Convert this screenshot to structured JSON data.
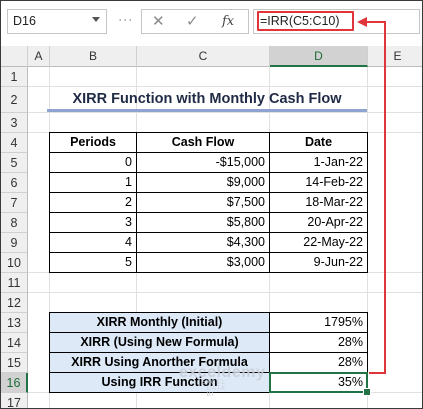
{
  "formula_bar": {
    "name_box": "D16",
    "cancel_symbol": "✕",
    "enter_symbol": "✓",
    "fx_symbol": "fx",
    "formula": "=IRR(C5:C10)"
  },
  "columns": [
    "A",
    "B",
    "C",
    "D",
    "E"
  ],
  "selected_column": "D",
  "rows": [
    "1",
    "2",
    "3",
    "4",
    "5",
    "6",
    "7",
    "8",
    "9",
    "10",
    "11",
    "12",
    "13",
    "14",
    "15",
    "16",
    "17"
  ],
  "selected_row": "16",
  "title": "XIRR Function with Monthly Cash Flow",
  "table": {
    "headers": {
      "periods": "Periods",
      "cash_flow": "Cash Flow",
      "date": "Date"
    },
    "rows": [
      {
        "period": "0",
        "cash_flow": "-$15,000",
        "date": "1-Jan-22"
      },
      {
        "period": "1",
        "cash_flow": "$9,000",
        "date": "14-Feb-22"
      },
      {
        "period": "2",
        "cash_flow": "$7,500",
        "date": "18-Mar-22"
      },
      {
        "period": "3",
        "cash_flow": "$5,800",
        "date": "20-Apr-22"
      },
      {
        "period": "4",
        "cash_flow": "$4,300",
        "date": "22-May-22"
      },
      {
        "period": "5",
        "cash_flow": "$3,000",
        "date": "9-Jun-22"
      }
    ]
  },
  "results": [
    {
      "label": "XIRR Monthly (Initial)",
      "value": "1795%"
    },
    {
      "label": "XIRR (Using New Formula)",
      "value": "28%"
    },
    {
      "label": "XIRR Using Anorther Formula",
      "value": "28%"
    },
    {
      "label": "Using IRR Function",
      "value": "35%"
    }
  ],
  "watermark": {
    "brand": "exceldemy",
    "tagline": "EXCEL · DATA · BI"
  },
  "colors": {
    "accent_green": "#217346",
    "annotation_red": "#e0353b",
    "label_fill": "#dde9f7",
    "title_underline": "#8ea3cf"
  }
}
